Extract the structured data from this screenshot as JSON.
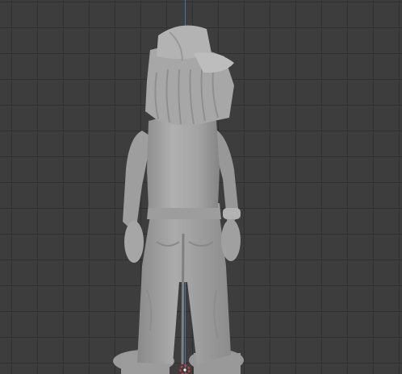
{
  "viewport": {
    "background_color": "#3d3d3d",
    "grid_color": "#303030",
    "axis_z_color": "#4a6fb0",
    "model_color": "#a3a3a3"
  },
  "model": {
    "icon": "sculpted-character-model"
  },
  "origin": {
    "icon": "3d-cursor-icon",
    "colors": [
      "#d63b3b",
      "#ffffff"
    ]
  }
}
